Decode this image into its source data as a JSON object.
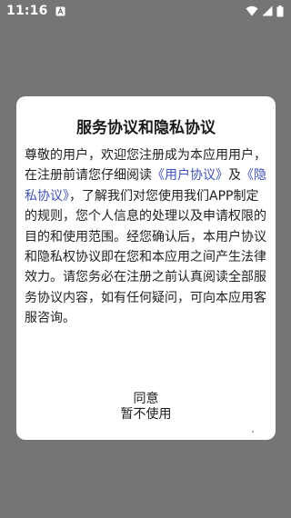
{
  "status_bar": {
    "time": "11:16",
    "icons": [
      "notification-a-icon",
      "wifi-icon",
      "cellular-signal-icon",
      "battery-icon"
    ]
  },
  "dialog": {
    "title": "服务协议和隐私协议",
    "body_text_1": "尊敬的用户，欢迎您注册成为本应用用户，在注册前请您仔细阅读",
    "link_user_agreement": "《用户协议》",
    "and_text": "及",
    "link_privacy_agreement": "《隐私协议》",
    "body_text_2": "，了解我们对您使用我们APP制定的规则，您个人信息的处理以及申请权限的目的和使用范围。经您确认后，本用户协议和隐私权协议即在您和本应用之间产生法律效力。请您务必在注册之前认真阅读全部服务协议内容，如有任何疑问，可向本应用客服咨询。",
    "agree_label": "同意",
    "decline_label": "暂不使用"
  },
  "colors": {
    "overlay": "#757575",
    "link": "#3f51b5",
    "dialog_bg": "#ffffff"
  }
}
